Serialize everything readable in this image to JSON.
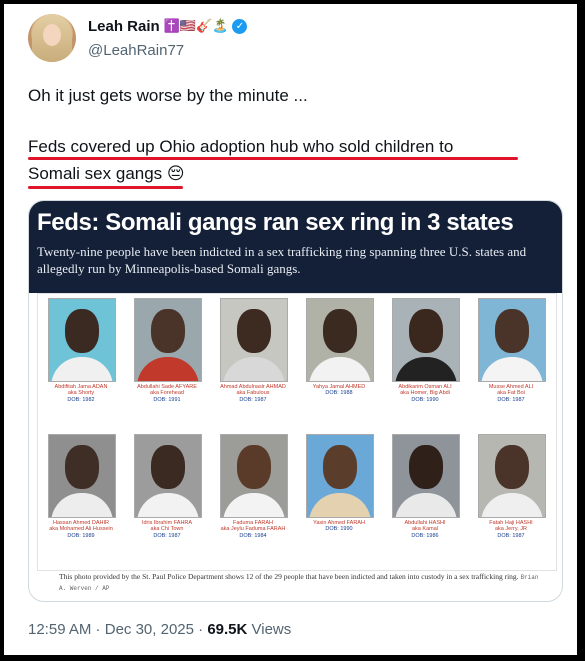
{
  "author": {
    "name": "Leah Rain",
    "handle": "@LeahRain77",
    "name_emojis": "✝️🇺🇸🎸🏝️",
    "verified_badge": "✓"
  },
  "tweet": {
    "line1": "Oh it just gets worse by the minute ...",
    "line2": "Feds covered up Ohio adoption hub who sold children to",
    "line3": "Somali sex gangs",
    "line3_emoji": "😔"
  },
  "article": {
    "headline": "Feds: Somali gangs ran sex ring in 3 states",
    "subhead": "Twenty-nine people have been indicted in a sex trafficking ring spanning three U.S. states and allegedly run by Minneapolis-based Somali gangs.",
    "caption": "This photo provided by the St. Paul Police Department shows 12 of the 29 people that have been indicted and taken into custody in a sex trafficking ring.",
    "credit": "Brian A. Werven / AP",
    "mugshots": [
      {
        "name": "Abdifitah Jama ADAN",
        "aka": "aka Shorty",
        "dob": "DOB: 1982"
      },
      {
        "name": "Abdullahi Sade AFYARE",
        "aka": "aka Forehead",
        "dob": "DOB: 1991"
      },
      {
        "name": "Ahmad Abdulnasir AHMAD",
        "aka": "aka Fabulous",
        "dob": "DOB: 1987"
      },
      {
        "name": "Yahya Jamal AHMED",
        "aka": "",
        "dob": "DOB: 1988"
      },
      {
        "name": "Abdikarim Osman ALI",
        "aka": "aka Homer, Big Abdi",
        "dob": "DOB: 1990"
      },
      {
        "name": "Musse Ahmed ALI",
        "aka": "aka Fat Boi",
        "dob": "DOB: 1987"
      },
      {
        "name": "Hassan Ahmed DAHIR",
        "aka": "aka Mohamed Ali Hussein",
        "dob": "DOB: 1989"
      },
      {
        "name": "Idris Ibrahim FAHRA",
        "aka": "aka Chi Town",
        "dob": "DOB: 1987"
      },
      {
        "name": "Faduma FARAH",
        "aka": "aka Jeylu Faduma FARAH",
        "dob": "DOB: 1984"
      },
      {
        "name": "Yasin Ahmed FARAH",
        "aka": "",
        "dob": "DOB: 1990"
      },
      {
        "name": "Abdullahi HASHI",
        "aka": "aka Kamal",
        "dob": "DOB: 1986"
      },
      {
        "name": "Fatah Haji HASHI",
        "aka": "aka Jerry, JR",
        "dob": "DOB: 1987"
      }
    ]
  },
  "meta": {
    "time": "12:59 AM",
    "sep1": " · ",
    "date": "Dec 30, 2025",
    "sep2": " · ",
    "views_count": "69.5K",
    "views_label": " Views"
  },
  "colors": {
    "accent_red": "#e0142a",
    "verified_blue": "#1d9bf0",
    "headline_bg": "#142038"
  }
}
